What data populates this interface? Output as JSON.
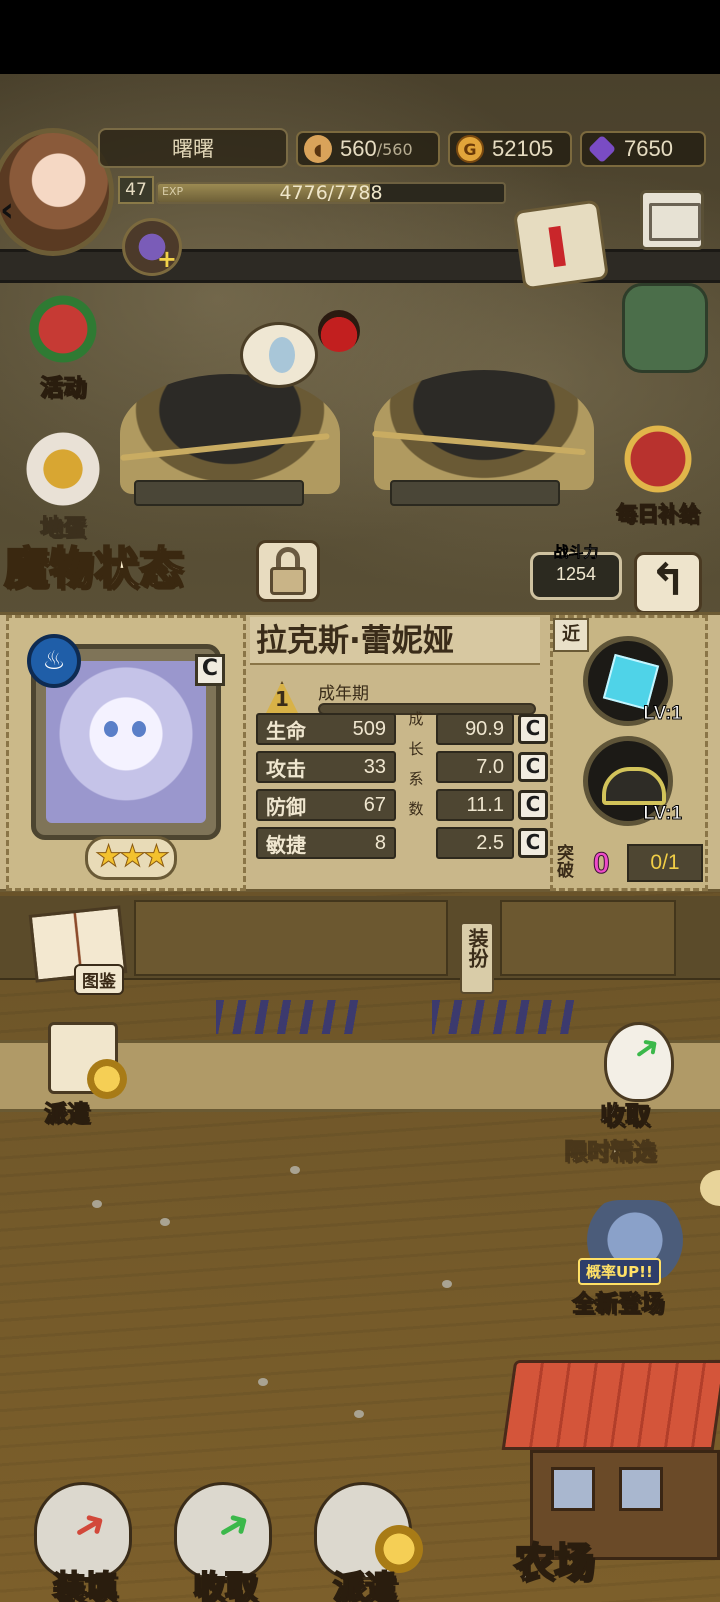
{
  "hud": {
    "player_name": "曙曙",
    "stamina": "560",
    "stamina_max": "/560",
    "gold": "52105",
    "gold_icon": "G",
    "gems": "7650",
    "level": "47",
    "exp_tag": "EXP",
    "exp_text": "4776/7788",
    "exp_progress": 0.613
  },
  "side_buttons": {
    "activity": "活动",
    "egg": "地蛋",
    "daily_supply": "每日补给"
  },
  "header": {
    "title": "魔物状态",
    "power_label": "战斗力",
    "power_value": "1254",
    "return_glyph": "↰"
  },
  "monster": {
    "name": "拉克斯·蕾妮娅",
    "element_glyph": "♨",
    "rank": "C",
    "stars": "★★★",
    "stage_number": "1",
    "stage_label": "成年期",
    "growth_label_chars": [
      "成",
      "长",
      "系",
      "数"
    ],
    "stats": [
      {
        "label": "生命",
        "value": "509",
        "growth": "90.9",
        "grade": "C"
      },
      {
        "label": "攻击",
        "value": "33",
        "growth": "7.0",
        "grade": "C"
      },
      {
        "label": "防御",
        "value": "67",
        "growth": "11.1",
        "grade": "C"
      },
      {
        "label": "敏捷",
        "value": "8",
        "growth": "2.5",
        "grade": "C"
      }
    ]
  },
  "skills": {
    "range": "近",
    "skill1_level": "LV:1",
    "skill2_level": "LV:1",
    "breakthrough_label": "突破",
    "breakthrough_count": "0",
    "breakthrough_ratio": "0/1"
  },
  "actions": {
    "encyclopedia": "图鉴",
    "dress_up": "装扮",
    "dispatch": "派遣",
    "collect": "收取",
    "limited_pick": "限时精选",
    "new_arrival": "全新登场",
    "new_arrival_tag": "概率UP!!",
    "farm": "农场",
    "chat_glyph": "•••"
  },
  "bottom_bar": {
    "load": "装填",
    "collect": "收取",
    "dispatch": "派遣"
  },
  "colors": {
    "panel": "#c9b78a",
    "dark_cell": "#4e4632",
    "label_text": "#fff6dc",
    "breakthrough_pink": "#ee4cc8"
  }
}
